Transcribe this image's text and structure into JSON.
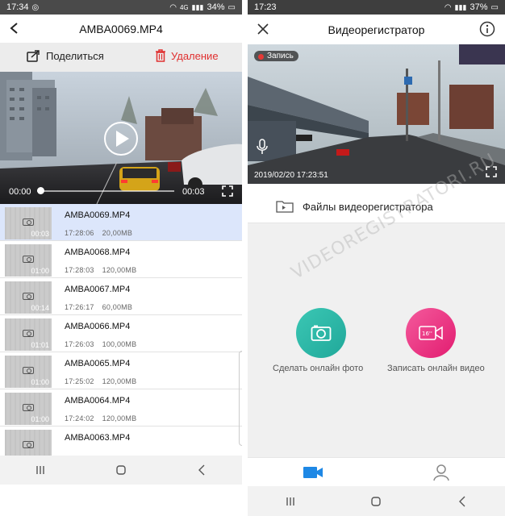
{
  "left": {
    "status": {
      "time": "17:34",
      "signal": "4G",
      "battery": "34%"
    },
    "header": {
      "title": "AMBA0069.MP4"
    },
    "actions": {
      "share": "Поделиться",
      "delete": "Удаление"
    },
    "player": {
      "current": "00:00",
      "duration": "00:03",
      "progress": 0
    },
    "files": [
      {
        "name": "AMBA0069.MP4",
        "time": "17:28:06",
        "size": "20,00MB",
        "duration": "00:03",
        "selected": true
      },
      {
        "name": "AMBA0068.MP4",
        "time": "17:28:03",
        "size": "120,00MB",
        "duration": "01:00",
        "selected": false
      },
      {
        "name": "AMBA0067.MP4",
        "time": "17:26:17",
        "size": "60,00MB",
        "duration": "00:14",
        "selected": false
      },
      {
        "name": "AMBA0066.MP4",
        "time": "17:26:03",
        "size": "100,00MB",
        "duration": "01:01",
        "selected": false
      },
      {
        "name": "AMBA0065.MP4",
        "time": "17:25:02",
        "size": "120,00MB",
        "duration": "01:00",
        "selected": false
      },
      {
        "name": "AMBA0064.MP4",
        "time": "17:24:02",
        "size": "120,00MB",
        "duration": "01:00",
        "selected": false
      },
      {
        "name": "AMBA0063.MP4",
        "time": "",
        "size": "",
        "duration": "",
        "selected": false
      }
    ]
  },
  "right": {
    "status": {
      "time": "17:23",
      "battery": "37%"
    },
    "header": {
      "title": "Видеорегистратор"
    },
    "live": {
      "rec_label": "Запись",
      "timestamp": "2019/02/20 17:23:51"
    },
    "section": {
      "label": "Файлы видеорегистратора"
    },
    "photo_label": "Сделать онлайн фото",
    "video_label": "Записать онлайн видео",
    "video_badge": "16''",
    "watermark": "VIDEOREGISTRATORI.RU"
  },
  "colors": {
    "accent_blue": "#1e88e5",
    "delete_red": "#e03030",
    "photo_green": "#2bb5a5",
    "video_pink": "#ea2c7d",
    "selected_row": "#dce6fb"
  },
  "icons": [
    "back-arrow-icon",
    "share-icon",
    "trash-icon",
    "play-icon",
    "fullscreen-icon",
    "close-icon",
    "info-icon",
    "mic-icon",
    "folder-icon",
    "camera-icon",
    "video-camera-icon",
    "user-icon"
  ]
}
